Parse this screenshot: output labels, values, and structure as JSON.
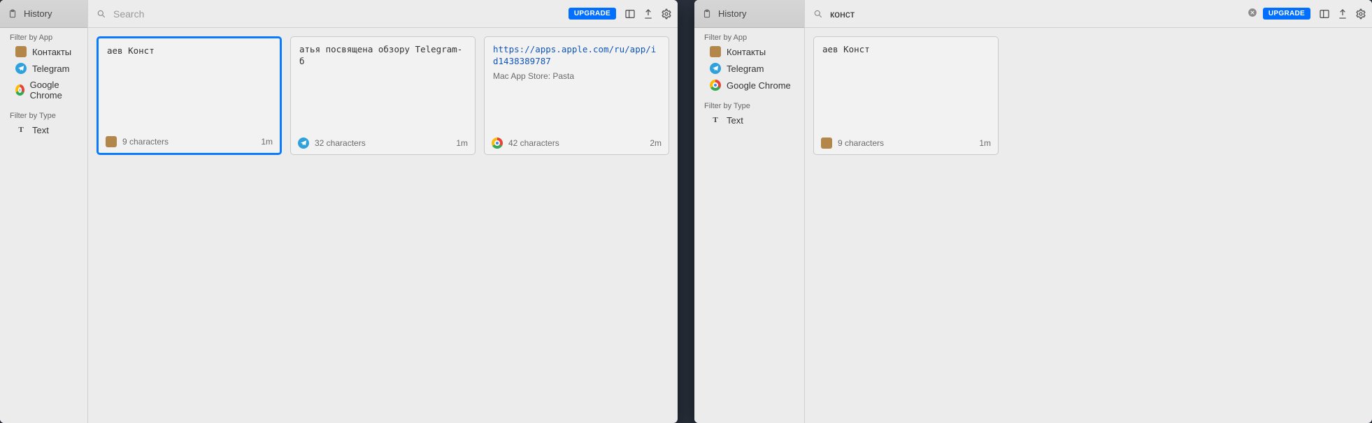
{
  "left": {
    "sidebar": {
      "title": "History",
      "filter_app_label": "Filter by App",
      "apps": [
        {
          "name": "Контакты",
          "icon": "contacts"
        },
        {
          "name": "Telegram",
          "icon": "telegram"
        },
        {
          "name": "Google Chrome",
          "icon": "chrome"
        }
      ],
      "filter_type_label": "Filter by Type",
      "types": [
        {
          "name": "Text",
          "icon": "text"
        }
      ]
    },
    "toolbar": {
      "search_placeholder": "Search",
      "search_value": "",
      "upgrade_label": "UPGRADE"
    },
    "cards": [
      {
        "text": "аев Конст",
        "subtitle": "",
        "is_link": false,
        "source_icon": "contacts",
        "chars_label": "9 characters",
        "age": "1m",
        "selected": true
      },
      {
        "text": "атья посвящена обзору Telegram-б",
        "subtitle": "",
        "is_link": false,
        "source_icon": "telegram",
        "chars_label": "32 characters",
        "age": "1m",
        "selected": false
      },
      {
        "text": "https://apps.apple.com/ru/app/id1438389787",
        "subtitle": "Mac App Store: Pasta",
        "is_link": true,
        "source_icon": "chrome",
        "chars_label": "42 characters",
        "age": "2m",
        "selected": false
      }
    ]
  },
  "right": {
    "sidebar": {
      "title": "History",
      "filter_app_label": "Filter by App",
      "apps": [
        {
          "name": "Контакты",
          "icon": "contacts"
        },
        {
          "name": "Telegram",
          "icon": "telegram"
        },
        {
          "name": "Google Chrome",
          "icon": "chrome"
        }
      ],
      "filter_type_label": "Filter by Type",
      "types": [
        {
          "name": "Text",
          "icon": "text"
        }
      ]
    },
    "toolbar": {
      "search_placeholder": "Search",
      "search_value": "конст",
      "upgrade_label": "UPGRADE"
    },
    "cards": [
      {
        "text": "аев Конст",
        "subtitle": "",
        "is_link": false,
        "source_icon": "contacts",
        "chars_label": "9 characters",
        "age": "1m",
        "selected": false
      }
    ]
  }
}
